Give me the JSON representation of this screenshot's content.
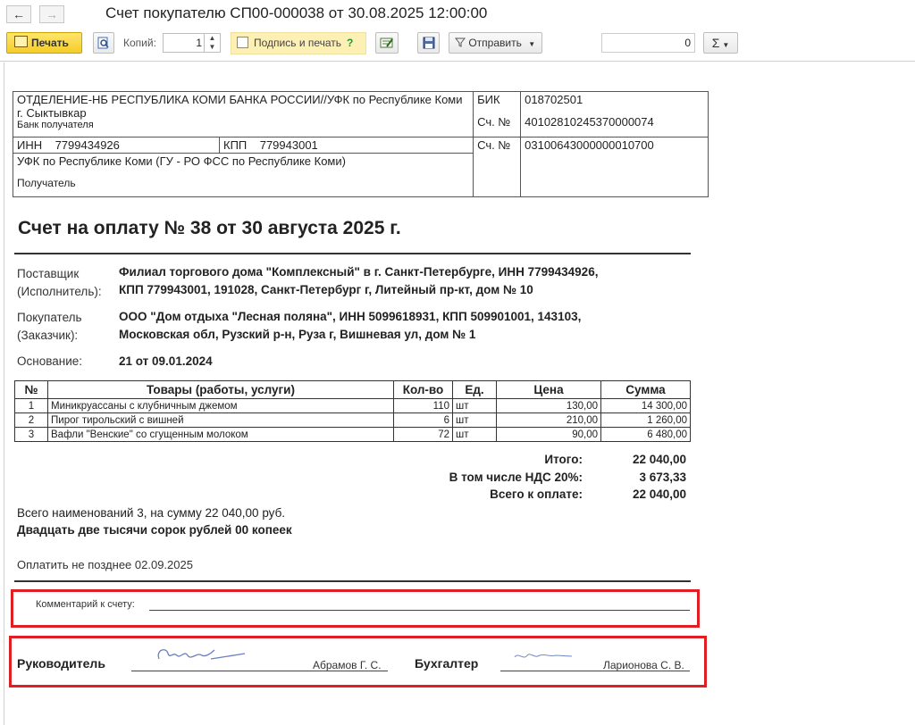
{
  "window": {
    "title": "Счет покупателю СП00-000038 от 30.08.2025 12:00:00",
    "back_icon": "←",
    "forward_icon": "→"
  },
  "toolbar": {
    "print_label": "Печать",
    "copies_label": "Копий:",
    "copies_value": "1",
    "sign_label": "Подпись и печать",
    "help_mark": "?",
    "send_label": "Отправить",
    "sum_value": "0",
    "sum_symbol": "Σ"
  },
  "bank": {
    "bank_name": "ОТДЕЛЕНИЕ-НБ РЕСПУБЛИКА КОМИ БАНКА РОССИИ//УФК по Республике Коми г. Сыктывкар",
    "bank_caption": "Банк получателя",
    "bik_label": "БИК",
    "bik_value": "018702501",
    "acc_label": "Сч. №",
    "acc_value": "40102810245370000074",
    "inn_label": "ИНН",
    "inn_value": "7799434926",
    "kpp_label": "КПП",
    "kpp_value": "779943001",
    "acc2_label": "Сч. №",
    "acc2_value": "03100643000000010700",
    "recipient_name": "УФК по Республике Коми (ГУ - РО ФСС по Республике Коми)",
    "recipient_caption": "Получатель"
  },
  "invoice": {
    "title": "Счет на оплату № 38 от 30 августа 2025 г.",
    "supplier_label_1": "Поставщик",
    "supplier_label_2": "(Исполнитель):",
    "supplier_line_1": "Филиал торгового дома \"Комплексный\" в г. Санкт-Петербурге, ИНН 7799434926,",
    "supplier_line_2": "КПП 779943001, 191028, Санкт-Петербург г, Литейный пр-кт, дом № 10",
    "buyer_label_1": "Покупатель",
    "buyer_label_2": "(Заказчик):",
    "buyer_line_1": "ООО \"Дом отдыха \"Лесная поляна\", ИНН 5099618931, КПП 509901001, 143103,",
    "buyer_line_2": "Московская обл, Рузский р-н, Руза г, Вишневая ул, дом № 1",
    "basis_label": "Основание:",
    "basis_value": "21 от 09.01.2024"
  },
  "goods": {
    "headers": [
      "№",
      "Товары (работы, услуги)",
      "Кол-во",
      "Ед.",
      "Цена",
      "Сумма"
    ],
    "rows": [
      {
        "n": "1",
        "name": "Миникруассаны с клубничным джемом",
        "qty": "110",
        "unit": "шт",
        "price": "130,00",
        "sum": "14 300,00"
      },
      {
        "n": "2",
        "name": "Пирог тирольский с вишней",
        "qty": "6",
        "unit": "шт",
        "price": "210,00",
        "sum": "1 260,00"
      },
      {
        "n": "3",
        "name": "Вафли \"Венские\" со сгущенным молоком",
        "qty": "72",
        "unit": "шт",
        "price": "90,00",
        "sum": "6 480,00"
      }
    ]
  },
  "totals": {
    "total_label": "Итого:",
    "total_value": "22 040,00",
    "vat_label": "В том числе НДС 20%:",
    "vat_value": "3 673,33",
    "due_label": "Всего к оплате:",
    "due_value": "22 040,00"
  },
  "summary": {
    "count_line": "Всего наименований 3, на сумму 22 040,00 руб.",
    "words_line": "Двадцать две тысячи сорок рублей 00 копеек",
    "pay_by": "Оплатить не позднее 02.09.2025"
  },
  "comment": {
    "label": "Комментарий к счету:"
  },
  "signatures": {
    "director_label": "Руководитель",
    "director_name": "Абрамов Г. С.",
    "accountant_label": "Бухгалтер",
    "accountant_name": "Ларионова С. В."
  }
}
